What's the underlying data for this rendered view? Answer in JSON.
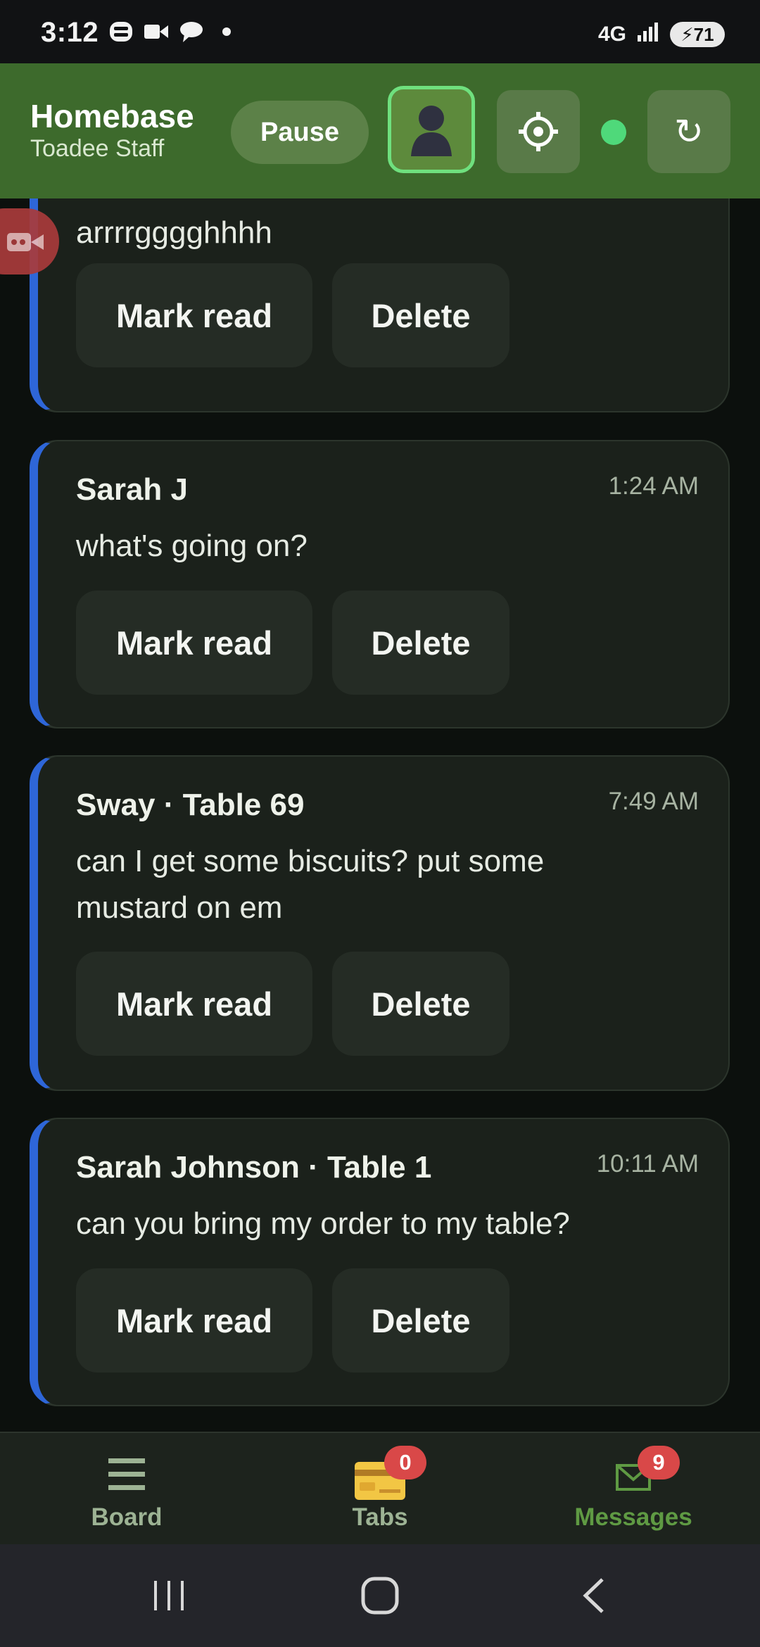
{
  "status_bar": {
    "time": "3:12",
    "network": "4G",
    "battery": "71"
  },
  "header": {
    "title": "Homebase",
    "subtitle": "Toadee Staff",
    "pause_label": "Pause",
    "refresh_glyph": "↻",
    "status_color": "#4fd97a"
  },
  "messages": [
    {
      "sender": "",
      "time": "",
      "text": "arrrrgggghhhh",
      "mark_read_label": "Mark read",
      "delete_label": "Delete"
    },
    {
      "sender": "Sarah J",
      "time": "1:24 AM",
      "text": "what's going on?",
      "mark_read_label": "Mark read",
      "delete_label": "Delete"
    },
    {
      "sender": "Sway · Table 69",
      "time": "7:49 AM",
      "text": "can I get some biscuits? put some mustard on em",
      "mark_read_label": "Mark read",
      "delete_label": "Delete"
    },
    {
      "sender": "Sarah Johnson · Table 1",
      "time": "10:11 AM",
      "text": "can you bring my order to my table?",
      "mark_read_label": "Mark read",
      "delete_label": "Delete"
    }
  ],
  "bottom_nav": {
    "board": {
      "label": "Board",
      "icon": "menu-icon"
    },
    "tabs": {
      "label": "Tabs",
      "badge": "0",
      "icon": "credit-card-icon"
    },
    "messages": {
      "label": "Messages",
      "badge": "9",
      "icon": "envelope-icon",
      "active": true
    }
  },
  "colors": {
    "header_bg": "#3d6a2c",
    "accent_green": "#6fe07e",
    "card_border_accent": "#2e66d8",
    "badge": "#d94848"
  }
}
